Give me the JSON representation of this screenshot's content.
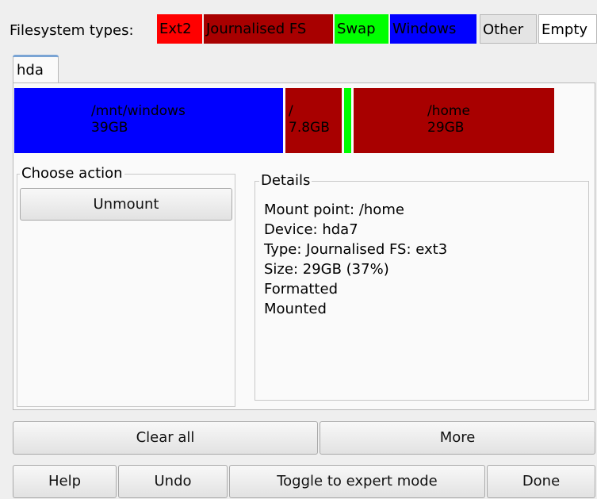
{
  "legend": {
    "label": "Filesystem types:",
    "items": [
      {
        "label": "Ext2",
        "bg": "#ff0000",
        "fg": "#000000"
      },
      {
        "label": "Journalised FS",
        "bg": "#a80000",
        "fg": "#000000"
      },
      {
        "label": "Swap",
        "bg": "#00ff00",
        "fg": "#000000"
      },
      {
        "label": "Windows",
        "bg": "#0000ff",
        "fg": "#000000"
      },
      {
        "label": "Other",
        "bg": "#e4e4e4",
        "fg": "#000000"
      },
      {
        "label": "Empty",
        "bg": "#ffffff",
        "fg": "#000000"
      }
    ]
  },
  "tab": {
    "label": "hda"
  },
  "partitions": [
    {
      "mount": "/mnt/windows",
      "size": "39GB",
      "color": "#0000ff"
    },
    {
      "mount": "/",
      "size": "7.8GB",
      "color": "#a80000"
    },
    {
      "mount": "",
      "size": "",
      "color": "#00ff00"
    },
    {
      "mount": "/home",
      "size": "29GB",
      "color": "#a80000"
    }
  ],
  "choose_action": {
    "title": "Choose action",
    "buttons": [
      "Unmount"
    ]
  },
  "details": {
    "title": "Details",
    "lines": [
      "Mount point: /home",
      "Device: hda7",
      "Type: Journalised FS: ext3",
      "Size: 29GB (37%)",
      "Formatted",
      "Mounted"
    ]
  },
  "actions_row": {
    "clear_all": "Clear all",
    "more": "More"
  },
  "bottom_row": {
    "help": "Help",
    "undo": "Undo",
    "toggle": "Toggle to expert mode",
    "done": "Done"
  }
}
